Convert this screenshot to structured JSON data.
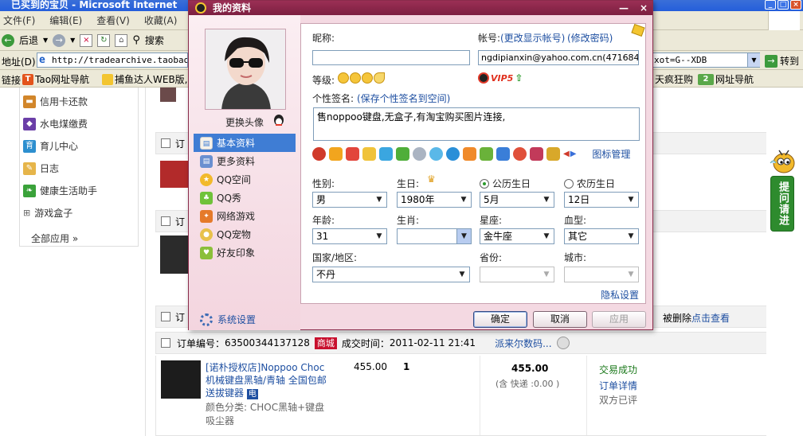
{
  "ie": {
    "title": "已买到的宝贝 - Microsoft Internet",
    "menu": [
      "文件(F)",
      "编辑(E)",
      "查看(V)",
      "收藏(A)"
    ],
    "toolbar": {
      "back": "后退",
      "search": "搜索"
    },
    "address": {
      "label": "地址(D)",
      "url": "http://tradearchive.taobao.c",
      "url_tail": "xot=G--XDB",
      "go": "转到"
    },
    "links": {
      "label": "链接",
      "items": [
        "Tao网址导航",
        "捕鱼达人WEB版,",
        "天疯狂购",
        "网址导航"
      ]
    }
  },
  "side": {
    "items": [
      "信用卡还款",
      "水电煤缴费",
      "育儿中心",
      "日志",
      "健康生活助手",
      "游戏盒子"
    ],
    "all": "全部应用 »"
  },
  "orders": {
    "bar_prefix": "订",
    "delete_tip": "被删除",
    "delete_link": "点击查看",
    "order_no_label": "订单编号：",
    "order_no": "63500344137128",
    "mall_badge": "商城",
    "time_label": "成交时间：",
    "time": "2011-02-11 21:41",
    "seller": "派来尔数码...",
    "item_title": "[诺朴授权店]Noppoo Choc 机械键盘黑轴/青轴 全国包邮送拔键器",
    "item_badge": "电",
    "item_attr": "颜色分类: CHOC黑轴+键盘吸尘器",
    "price": "455.00",
    "qty": "1",
    "total": "455.00",
    "shipping": "(含 快递 :0.00 )",
    "status": "交易成功",
    "detail_link": "订单详情",
    "review": "双方已评"
  },
  "ask": {
    "label": "提问请进"
  },
  "dialog": {
    "title": "我的资料",
    "change_avatar": "更换头像",
    "nav": [
      "基本资料",
      "更多资料",
      "QQ空间",
      "QQ秀",
      "网络游戏",
      "QQ宠物",
      "好友印象"
    ],
    "sys_settings": "系统设置",
    "nickname_label": "昵称:",
    "nickname_value": "",
    "account_label": "帐号:",
    "account_link1": "(更改显示帐号)",
    "account_link2": "(修改密码)",
    "account_value": "ngdipianxin@yahoo.com.cn(471684467)",
    "level_label": "等级:",
    "vip_text": "VIP5",
    "signature_label": "个性签名:",
    "signature_link": "(保存个性签名到空间)",
    "signature_value": "售noppoo键盘,无盒子,有淘宝购买图片连接,",
    "icon_manage": "图标管理",
    "gender_label": "性别:",
    "gender_value": "男",
    "birthday_label": "生日:",
    "solar_label": "公历生日",
    "lunar_label": "农历生日",
    "year_value": "1980年",
    "month_value": "5月",
    "day_value": "12日",
    "age_label": "年龄:",
    "age_value": "31",
    "zodiac_label": "生肖:",
    "zodiac_value": "",
    "star_label": "星座:",
    "star_value": "金牛座",
    "blood_label": "血型:",
    "blood_value": "其它",
    "country_label": "国家/地区:",
    "country_value": "不丹",
    "province_label": "省份:",
    "city_label": "城市:",
    "privacy": "隐私设置",
    "ok": "确定",
    "cancel": "取消",
    "apply": "应用"
  },
  "colors": {
    "dialog_title": "#8a2c4b",
    "nav_active": "#3f7dd4",
    "link": "#1e4fa1",
    "mall": "#c8102e",
    "success": "#1d7a1d"
  }
}
